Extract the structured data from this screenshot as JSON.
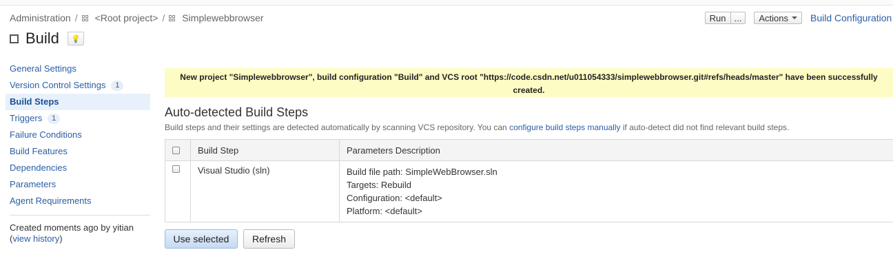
{
  "breadcrumb": {
    "administration": "Administration",
    "separator": "/",
    "root_project": "<Root project>",
    "project": "Simplewebbrowser"
  },
  "header": {
    "title": "Build",
    "run_label": "Run",
    "run_more_label": "...",
    "actions_label": "Actions",
    "build_config_link": "Build Configuration H"
  },
  "sidebar": {
    "items": [
      {
        "label": "General Settings"
      },
      {
        "label": "Version Control Settings",
        "badge": "1"
      },
      {
        "label": "Build Steps",
        "active": true
      },
      {
        "label": "Triggers",
        "badge": "1"
      },
      {
        "label": "Failure Conditions"
      },
      {
        "label": "Build Features"
      },
      {
        "label": "Dependencies"
      },
      {
        "label": "Parameters"
      },
      {
        "label": "Agent Requirements"
      }
    ],
    "created_text": "Created moments ago by yitian",
    "view_history_open": "(",
    "view_history_link": "view history",
    "view_history_close": ")"
  },
  "notice": {
    "text": "New project \"Simplewebbrowser\", build configuration \"Build\" and VCS root \"https://code.csdn.net/u011054333/simplewebbrowser.git#refs/heads/master\" have been successfully created."
  },
  "main": {
    "section_title": "Auto-detected Build Steps",
    "desc_before": "Build steps and their settings are detected automatically by scanning VCS repository. You can ",
    "desc_link": "configure build steps manually",
    "desc_after": " if auto-detect did not find relevant build steps.",
    "table": {
      "headers": [
        "Build Step",
        "Parameters Description"
      ],
      "rows": [
        {
          "step": "Visual Studio (sln)",
          "params": [
            "Build file path: SimpleWebBrowser.sln",
            "Targets: Rebuild",
            "Configuration: <default>",
            "Platform: <default>"
          ]
        }
      ]
    },
    "use_selected_label": "Use selected",
    "refresh_label": "Refresh"
  },
  "colors": {
    "link": "#2a5ea6",
    "notice_bg": "#fdfcc5",
    "active_nav_bg": "#e8f1fb"
  }
}
